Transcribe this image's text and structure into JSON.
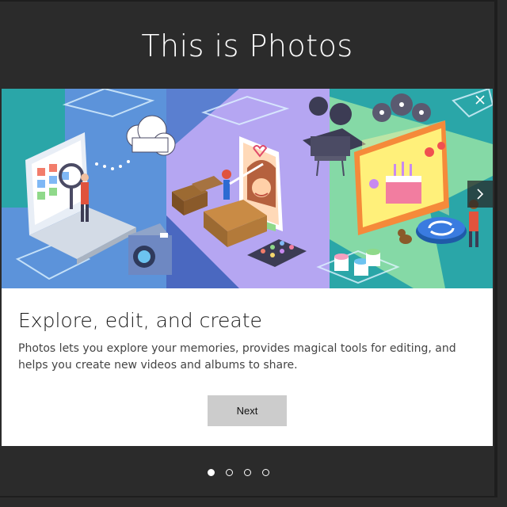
{
  "header": {
    "title": "This is Photos"
  },
  "card": {
    "heading": "Explore, edit, and create",
    "description": "Photos lets you explore your memories, provides magical tools for editing, and helps you create new videos and albums to share.",
    "next_label": "Next",
    "hero_icons": {
      "close": "close-icon",
      "next": "chevron-right-icon"
    }
  },
  "pager": {
    "count": 4,
    "active_index": 0
  },
  "colors": {
    "background": "#2b2b2b",
    "panel_blue": "#5a8fd8",
    "panel_purple": "#b3a2f0",
    "panel_green": "#7fd6a4",
    "teal": "#1fa3a0",
    "button": "#cccccc"
  }
}
